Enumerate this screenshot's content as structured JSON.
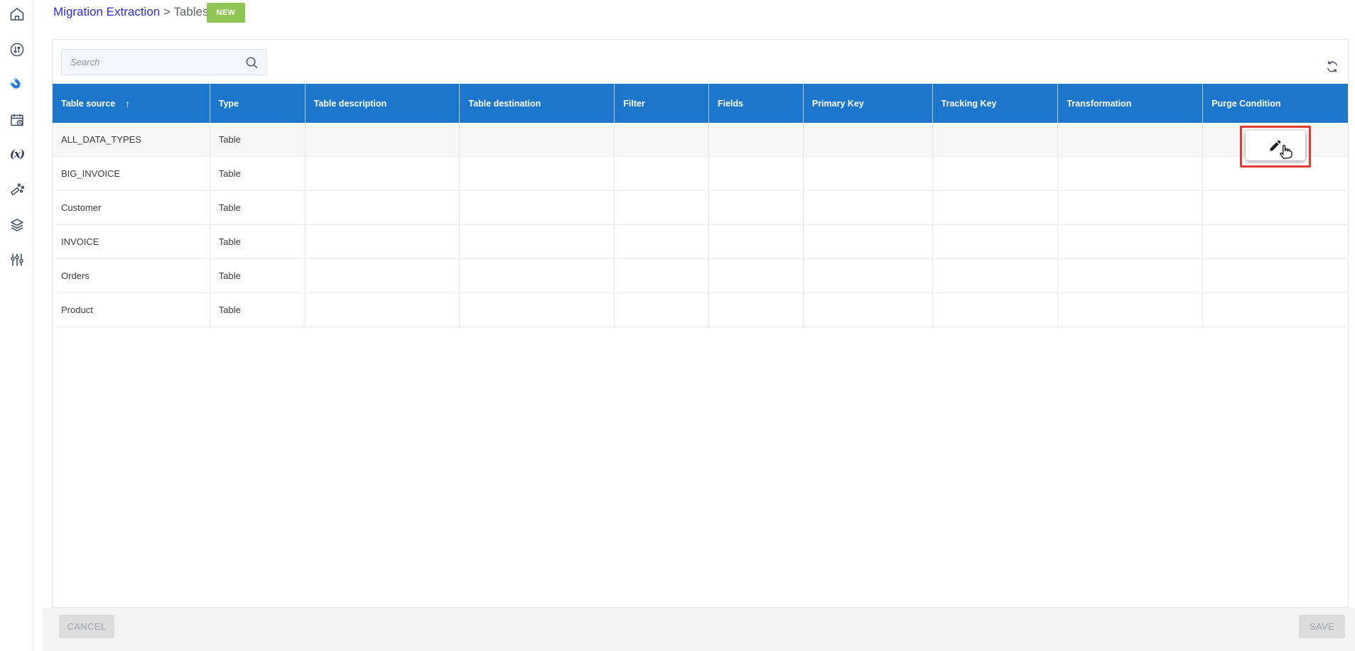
{
  "breadcrumb": {
    "parent": "Migration Extraction",
    "separator": ">",
    "current": "Tables"
  },
  "actions": {
    "new_label": "NEW",
    "cancel_label": "CANCEL",
    "save_label": "SAVE"
  },
  "search": {
    "placeholder": "Search",
    "value": ""
  },
  "sidebar": {
    "items": [
      {
        "icon": "home-icon"
      },
      {
        "icon": "sync-arrows-icon"
      },
      {
        "icon": "magnet-icon",
        "active": true,
        "color": "#2e7cd8"
      },
      {
        "icon": "calendar-clock-icon"
      },
      {
        "icon": "function-x-icon",
        "glyph": "(x)"
      },
      {
        "icon": "magic-wand-icon"
      },
      {
        "icon": "layers-icon"
      },
      {
        "icon": "sliders-icon"
      }
    ]
  },
  "toolbar_icons": {
    "search": "search-icon",
    "refresh": "refresh-icon"
  },
  "table": {
    "columns": [
      {
        "label": "Table source",
        "sort": "asc"
      },
      {
        "label": "Type"
      },
      {
        "label": "Table description"
      },
      {
        "label": "Table destination"
      },
      {
        "label": "Filter"
      },
      {
        "label": "Fields"
      },
      {
        "label": "Primary Key"
      },
      {
        "label": "Tracking Key"
      },
      {
        "label": "Transformation"
      },
      {
        "label": "Purge Condition"
      }
    ],
    "cell_keys": [
      "table_source",
      "type",
      "table_description",
      "table_destination",
      "filter",
      "fields",
      "primary_key",
      "tracking_key",
      "transformation",
      "purge_condition"
    ],
    "rows": [
      {
        "table_source": "ALL_DATA_TYPES",
        "type": "Table",
        "table_description": "",
        "table_destination": "",
        "filter": "",
        "fields": "",
        "primary_key": "",
        "tracking_key": "",
        "transformation": "",
        "purge_condition": "",
        "highlighted": true,
        "purge_edit_button": true
      },
      {
        "table_source": "BIG_INVOICE",
        "type": "Table",
        "table_description": "",
        "table_destination": "",
        "filter": "",
        "fields": "",
        "primary_key": "",
        "tracking_key": "",
        "transformation": "",
        "purge_condition": ""
      },
      {
        "table_source": "Customer",
        "type": "Table",
        "table_description": "",
        "table_destination": "",
        "filter": "",
        "fields": "",
        "primary_key": "",
        "tracking_key": "",
        "transformation": "",
        "purge_condition": ""
      },
      {
        "table_source": "INVOICE",
        "type": "Table",
        "table_description": "",
        "table_destination": "",
        "filter": "",
        "fields": "",
        "primary_key": "",
        "tracking_key": "",
        "transformation": "",
        "purge_condition": ""
      },
      {
        "table_source": "Orders",
        "type": "Table",
        "table_description": "",
        "table_destination": "",
        "filter": "",
        "fields": "",
        "primary_key": "",
        "tracking_key": "",
        "transformation": "",
        "purge_condition": ""
      },
      {
        "table_source": "Product",
        "type": "Table",
        "table_description": "",
        "table_destination": "",
        "filter": "",
        "fields": "",
        "primary_key": "",
        "tracking_key": "",
        "transformation": "",
        "purge_condition": ""
      }
    ],
    "annotation": {
      "edit_icon": "pencil-icon",
      "cursor": "hand-pointer-icon",
      "highlight_color": "#e23b33"
    }
  },
  "colors": {
    "table_header_blue": "#1b76cc",
    "breadcrumb_link_blue": "#2b2be2",
    "new_button_green": "#8fc653",
    "highlight_red": "#e23b33",
    "footer_gray": "#f4f4f4"
  }
}
